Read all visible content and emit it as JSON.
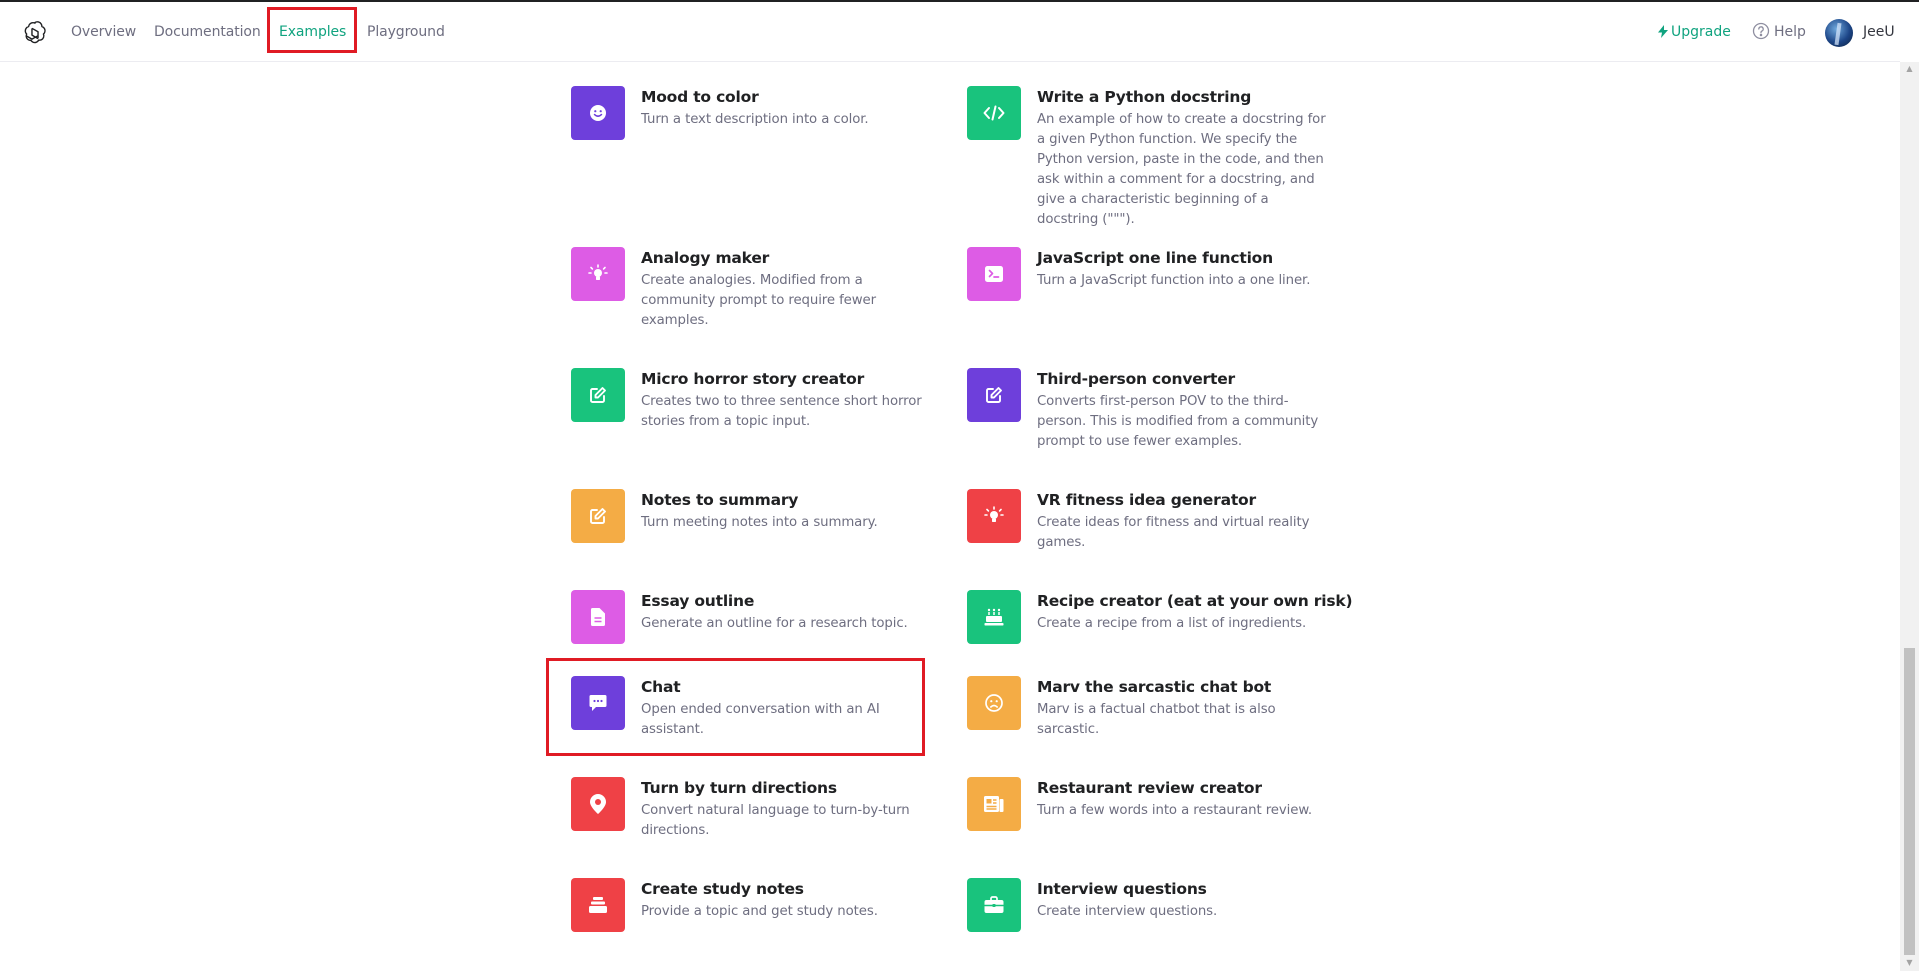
{
  "nav": {
    "links": [
      "Overview",
      "Documentation",
      "Examples",
      "Playground"
    ],
    "active": "Examples"
  },
  "header_right": {
    "upgrade": "Upgrade",
    "help": "Help",
    "username": "JeeU"
  },
  "colors": {
    "accent": "#10a37f",
    "purple": "#6e3fdb",
    "green": "#19c37d",
    "pink": "#dd5ce5",
    "orange": "#f4ac45",
    "red": "#ef4146",
    "highlight": "#e01b24"
  },
  "examples": [
    {
      "title": "Mood to color",
      "desc": "Turn a text description into a color.",
      "icon": "smile-icon",
      "color": "#6e3fdb"
    },
    {
      "title": "Write a Python docstring",
      "desc": "An example of how to create a docstring for a given Python function. We specify the Python version, paste in the code, and then ask within a comment for a docstring, and give a characteristic beginning of a docstring (\"\"\").",
      "icon": "code-icon",
      "color": "#19c37d"
    },
    {
      "title": "Analogy maker",
      "desc": "Create analogies. Modified from a community prompt to require fewer examples.",
      "icon": "lightbulb-icon",
      "color": "#dd5ce5"
    },
    {
      "title": "JavaScript one line function",
      "desc": "Turn a JavaScript function into a one liner.",
      "icon": "terminal-icon",
      "color": "#dd5ce5"
    },
    {
      "title": "Micro horror story creator",
      "desc": "Creates two to three sentence short horror stories from a topic input.",
      "icon": "edit-icon",
      "color": "#19c37d"
    },
    {
      "title": "Third-person converter",
      "desc": "Converts first-person POV to the third-person. This is modified from a community prompt to use fewer examples.",
      "icon": "edit-icon",
      "color": "#6e3fdb"
    },
    {
      "title": "Notes to summary",
      "desc": "Turn meeting notes into a summary.",
      "icon": "edit-icon",
      "color": "#f4ac45"
    },
    {
      "title": "VR fitness idea generator",
      "desc": "Create ideas for fitness and virtual reality games.",
      "icon": "lightbulb-icon",
      "color": "#ef4146"
    },
    {
      "title": "Essay outline",
      "desc": "Generate an outline for a research topic.",
      "icon": "document-icon",
      "color": "#dd5ce5"
    },
    {
      "title": "Recipe creator (eat at your own risk)",
      "desc": "Create a recipe from a list of ingredients.",
      "icon": "cake-icon",
      "color": "#19c37d"
    },
    {
      "title": "Chat",
      "desc": "Open ended conversation with an AI assistant.",
      "icon": "chat-icon",
      "color": "#6e3fdb"
    },
    {
      "title": "Marv the sarcastic chat bot",
      "desc": "Marv is a factual chatbot that is also sarcastic.",
      "icon": "frown-icon",
      "color": "#f4ac45"
    },
    {
      "title": "Turn by turn directions",
      "desc": "Convert natural language to turn-by-turn directions.",
      "icon": "map-pin-icon",
      "color": "#ef4146"
    },
    {
      "title": "Restaurant review creator",
      "desc": "Turn a few words into a restaurant review.",
      "icon": "newspaper-icon",
      "color": "#f4ac45"
    },
    {
      "title": "Create study notes",
      "desc": "Provide a topic and get study notes.",
      "icon": "stack-icon",
      "color": "#ef4146"
    },
    {
      "title": "Interview questions",
      "desc": "Create interview questions.",
      "icon": "briefcase-icon",
      "color": "#19c37d"
    }
  ]
}
